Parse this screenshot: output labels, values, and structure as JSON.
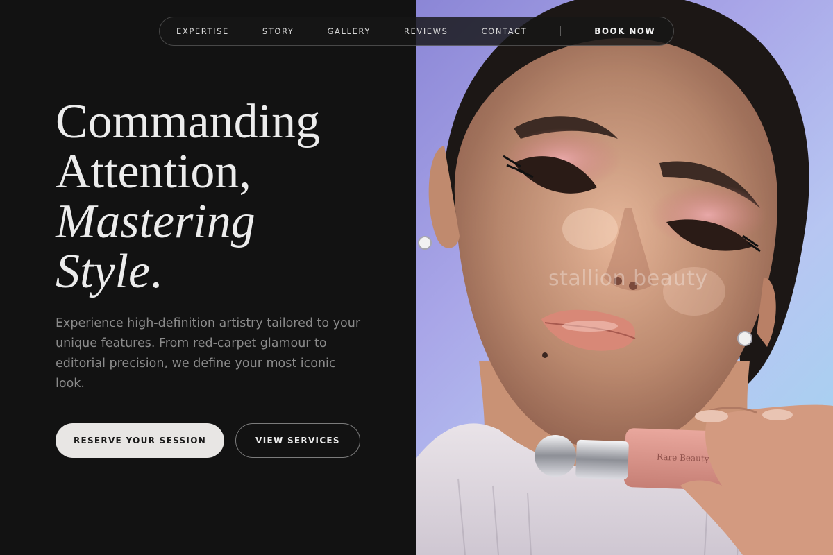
{
  "nav": {
    "links": [
      "EXPERTISE",
      "STORY",
      "GALLERY",
      "REVIEWS",
      "CONTACT"
    ],
    "cta_label": "BOOK NOW"
  },
  "hero": {
    "headline_line1": "Commanding",
    "headline_line2": "Attention,",
    "headline_line3": "Mastering",
    "headline_line4": "Style",
    "headline_period": ".",
    "description": "Experience high-definition artistry tailored to your unique features. From red-carpet glamour to editorial precision, we define your most iconic look.",
    "primary_button": "RESERVE YOUR SESSION",
    "secondary_button": "VIEW SERVICES"
  },
  "photo": {
    "watermark": "stallion beauty",
    "product_label": "Rare Beauty"
  },
  "colors": {
    "background": "#121212",
    "text": "#ececec",
    "muted_text": "#8a8a8a",
    "primary_button_bg": "#e8e6e4"
  }
}
